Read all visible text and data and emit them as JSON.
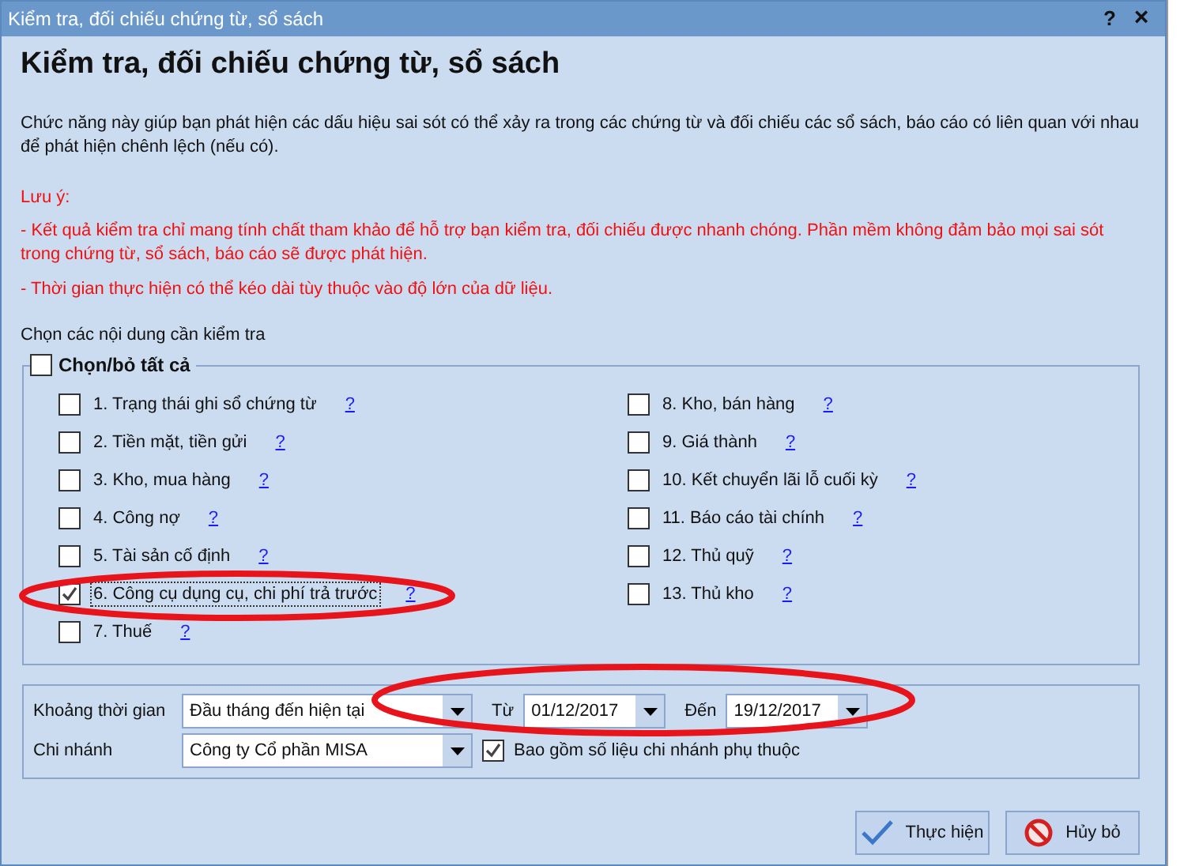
{
  "window": {
    "title": "Kiểm tra, đối chiếu chứng từ, sổ sách",
    "help": "?",
    "close": "×"
  },
  "heading": "Kiểm tra, đối chiếu chứng từ, sổ sách",
  "description": "Chức năng này giúp bạn phát hiện các dấu hiệu sai sót có thể xảy ra trong các chứng từ và đối chiếu các sổ sách, báo cáo có liên quan với nhau để phát hiện chênh lệch (nếu có).",
  "note": {
    "label": "Lưu ý:",
    "lines": [
      "- Kết quả kiểm tra chỉ mang tính chất tham khảo để hỗ trợ bạn kiểm tra, đối chiếu được nhanh chóng. Phần mềm không đảm bảo mọi sai sót trong chứng từ, sổ sách, báo cáo sẽ được phát hiện.",
      "- Thời gian thực hiện có thể kéo dài tùy thuộc vào độ lớn của dữ liệu."
    ]
  },
  "checks": {
    "label": "Chọn các nội dung cần kiểm tra",
    "select_all": {
      "label": "Chọn/bỏ tất cả",
      "checked": false
    },
    "items": [
      {
        "label": "1. Trạng thái ghi sổ chứng từ",
        "checked": false,
        "focused": false,
        "help": "?"
      },
      {
        "label": "2. Tiền mặt, tiền gửi",
        "checked": false,
        "focused": false,
        "help": "?"
      },
      {
        "label": "3. Kho, mua hàng",
        "checked": false,
        "focused": false,
        "help": "?"
      },
      {
        "label": "4. Công nợ",
        "checked": false,
        "focused": false,
        "help": "?"
      },
      {
        "label": "5. Tài sản cố định",
        "checked": false,
        "focused": false,
        "help": "?"
      },
      {
        "label": "6. Công cụ dụng cụ, chi phí trả trước",
        "checked": true,
        "focused": true,
        "help": "?"
      },
      {
        "label": "7. Thuế",
        "checked": false,
        "focused": false,
        "help": "?"
      },
      {
        "label": "8. Kho, bán hàng",
        "checked": false,
        "focused": false,
        "help": "?"
      },
      {
        "label": "9. Giá thành",
        "checked": false,
        "focused": false,
        "help": "?"
      },
      {
        "label": "10. Kết chuyển lãi lỗ cuối kỳ",
        "checked": false,
        "focused": false,
        "help": "?"
      },
      {
        "label": "11. Báo cáo tài chính",
        "checked": false,
        "focused": false,
        "help": "?"
      },
      {
        "label": "12. Thủ quỹ",
        "checked": false,
        "focused": false,
        "help": "?"
      },
      {
        "label": "13. Thủ kho",
        "checked": false,
        "focused": false,
        "help": "?"
      }
    ]
  },
  "filters": {
    "period": {
      "label": "Khoảng thời gian",
      "value": "Đầu tháng đến hiện tại"
    },
    "from": {
      "label": "Từ",
      "value": "01/12/2017"
    },
    "to": {
      "label": "Đến",
      "value": "19/12/2017"
    },
    "branch": {
      "label": "Chi nhánh",
      "value": "Công ty Cổ phần MISA"
    },
    "include_dependent": {
      "label": "Bao gồm số liệu chi nhánh phụ thuộc",
      "checked": true
    }
  },
  "buttons": [
    {
      "label": "Thực hiện",
      "kind": "ok"
    },
    {
      "label": "Hủy bỏ",
      "kind": "cancel"
    }
  ]
}
